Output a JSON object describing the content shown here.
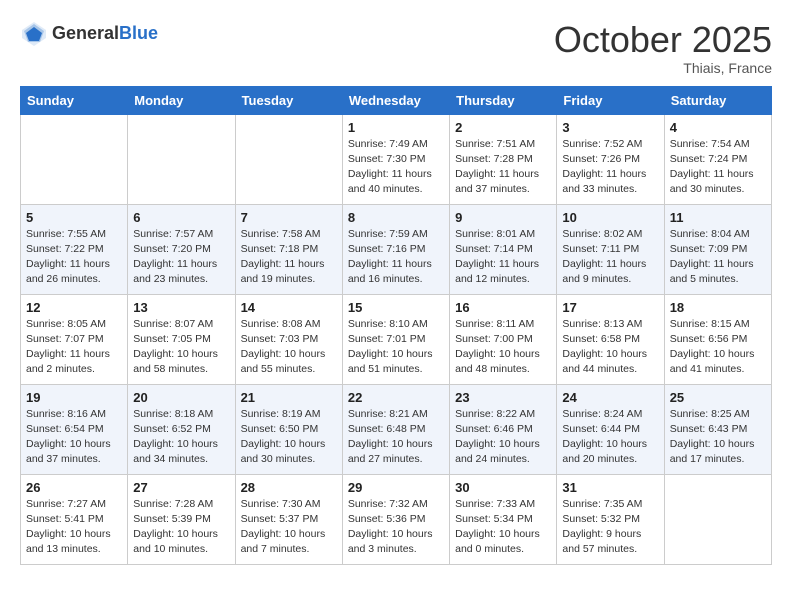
{
  "header": {
    "logo_general": "General",
    "logo_blue": "Blue",
    "month_title": "October 2025",
    "location": "Thiais, France"
  },
  "days_of_week": [
    "Sunday",
    "Monday",
    "Tuesday",
    "Wednesday",
    "Thursday",
    "Friday",
    "Saturday"
  ],
  "weeks": [
    [
      {
        "day": "",
        "info": ""
      },
      {
        "day": "",
        "info": ""
      },
      {
        "day": "",
        "info": ""
      },
      {
        "day": "1",
        "info": "Sunrise: 7:49 AM\nSunset: 7:30 PM\nDaylight: 11 hours\nand 40 minutes."
      },
      {
        "day": "2",
        "info": "Sunrise: 7:51 AM\nSunset: 7:28 PM\nDaylight: 11 hours\nand 37 minutes."
      },
      {
        "day": "3",
        "info": "Sunrise: 7:52 AM\nSunset: 7:26 PM\nDaylight: 11 hours\nand 33 minutes."
      },
      {
        "day": "4",
        "info": "Sunrise: 7:54 AM\nSunset: 7:24 PM\nDaylight: 11 hours\nand 30 minutes."
      }
    ],
    [
      {
        "day": "5",
        "info": "Sunrise: 7:55 AM\nSunset: 7:22 PM\nDaylight: 11 hours\nand 26 minutes."
      },
      {
        "day": "6",
        "info": "Sunrise: 7:57 AM\nSunset: 7:20 PM\nDaylight: 11 hours\nand 23 minutes."
      },
      {
        "day": "7",
        "info": "Sunrise: 7:58 AM\nSunset: 7:18 PM\nDaylight: 11 hours\nand 19 minutes."
      },
      {
        "day": "8",
        "info": "Sunrise: 7:59 AM\nSunset: 7:16 PM\nDaylight: 11 hours\nand 16 minutes."
      },
      {
        "day": "9",
        "info": "Sunrise: 8:01 AM\nSunset: 7:14 PM\nDaylight: 11 hours\nand 12 minutes."
      },
      {
        "day": "10",
        "info": "Sunrise: 8:02 AM\nSunset: 7:11 PM\nDaylight: 11 hours\nand 9 minutes."
      },
      {
        "day": "11",
        "info": "Sunrise: 8:04 AM\nSunset: 7:09 PM\nDaylight: 11 hours\nand 5 minutes."
      }
    ],
    [
      {
        "day": "12",
        "info": "Sunrise: 8:05 AM\nSunset: 7:07 PM\nDaylight: 11 hours\nand 2 minutes."
      },
      {
        "day": "13",
        "info": "Sunrise: 8:07 AM\nSunset: 7:05 PM\nDaylight: 10 hours\nand 58 minutes."
      },
      {
        "day": "14",
        "info": "Sunrise: 8:08 AM\nSunset: 7:03 PM\nDaylight: 10 hours\nand 55 minutes."
      },
      {
        "day": "15",
        "info": "Sunrise: 8:10 AM\nSunset: 7:01 PM\nDaylight: 10 hours\nand 51 minutes."
      },
      {
        "day": "16",
        "info": "Sunrise: 8:11 AM\nSunset: 7:00 PM\nDaylight: 10 hours\nand 48 minutes."
      },
      {
        "day": "17",
        "info": "Sunrise: 8:13 AM\nSunset: 6:58 PM\nDaylight: 10 hours\nand 44 minutes."
      },
      {
        "day": "18",
        "info": "Sunrise: 8:15 AM\nSunset: 6:56 PM\nDaylight: 10 hours\nand 41 minutes."
      }
    ],
    [
      {
        "day": "19",
        "info": "Sunrise: 8:16 AM\nSunset: 6:54 PM\nDaylight: 10 hours\nand 37 minutes."
      },
      {
        "day": "20",
        "info": "Sunrise: 8:18 AM\nSunset: 6:52 PM\nDaylight: 10 hours\nand 34 minutes."
      },
      {
        "day": "21",
        "info": "Sunrise: 8:19 AM\nSunset: 6:50 PM\nDaylight: 10 hours\nand 30 minutes."
      },
      {
        "day": "22",
        "info": "Sunrise: 8:21 AM\nSunset: 6:48 PM\nDaylight: 10 hours\nand 27 minutes."
      },
      {
        "day": "23",
        "info": "Sunrise: 8:22 AM\nSunset: 6:46 PM\nDaylight: 10 hours\nand 24 minutes."
      },
      {
        "day": "24",
        "info": "Sunrise: 8:24 AM\nSunset: 6:44 PM\nDaylight: 10 hours\nand 20 minutes."
      },
      {
        "day": "25",
        "info": "Sunrise: 8:25 AM\nSunset: 6:43 PM\nDaylight: 10 hours\nand 17 minutes."
      }
    ],
    [
      {
        "day": "26",
        "info": "Sunrise: 7:27 AM\nSunset: 5:41 PM\nDaylight: 10 hours\nand 13 minutes."
      },
      {
        "day": "27",
        "info": "Sunrise: 7:28 AM\nSunset: 5:39 PM\nDaylight: 10 hours\nand 10 minutes."
      },
      {
        "day": "28",
        "info": "Sunrise: 7:30 AM\nSunset: 5:37 PM\nDaylight: 10 hours\nand 7 minutes."
      },
      {
        "day": "29",
        "info": "Sunrise: 7:32 AM\nSunset: 5:36 PM\nDaylight: 10 hours\nand 3 minutes."
      },
      {
        "day": "30",
        "info": "Sunrise: 7:33 AM\nSunset: 5:34 PM\nDaylight: 10 hours\nand 0 minutes."
      },
      {
        "day": "31",
        "info": "Sunrise: 7:35 AM\nSunset: 5:32 PM\nDaylight: 9 hours\nand 57 minutes."
      },
      {
        "day": "",
        "info": ""
      }
    ]
  ]
}
